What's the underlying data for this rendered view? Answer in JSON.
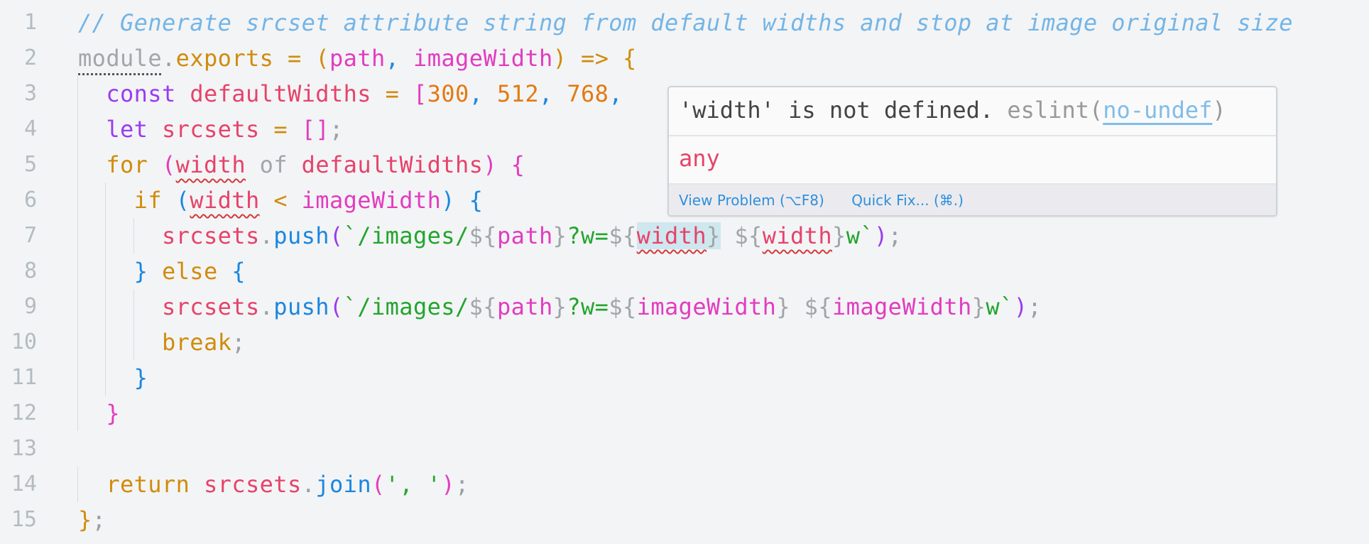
{
  "editor": {
    "lines": [
      {
        "num": "1",
        "indent": 0,
        "tokens": [
          [
            "// Generate srcset attribute string from default widths and stop at image original size",
            "comment"
          ]
        ]
      },
      {
        "num": "2",
        "indent": 0,
        "tokens": [
          [
            "module",
            "gray dots"
          ],
          [
            ".",
            "punc"
          ],
          [
            "exports",
            "ctl"
          ],
          [
            " = ",
            "ob"
          ],
          [
            "(",
            "ob"
          ],
          [
            "path",
            "param"
          ],
          [
            ", ",
            "bb"
          ],
          [
            "imageWidth",
            "param"
          ],
          [
            ")",
            "ob"
          ],
          [
            " => ",
            "ob"
          ],
          [
            "{",
            "ob"
          ]
        ]
      },
      {
        "num": "3",
        "indent": 1,
        "tokens": [
          [
            "const ",
            "kw"
          ],
          [
            "defaultWidths",
            "var"
          ],
          [
            " = ",
            "ob"
          ],
          [
            "[",
            "mb"
          ],
          [
            "300",
            "num"
          ],
          [
            ", ",
            "bb"
          ],
          [
            "512",
            "num"
          ],
          [
            ", ",
            "bb"
          ],
          [
            "768",
            "num"
          ],
          [
            ",",
            "bb"
          ]
        ]
      },
      {
        "num": "4",
        "indent": 1,
        "tokens": [
          [
            "let ",
            "kw"
          ],
          [
            "srcsets",
            "var"
          ],
          [
            " = ",
            "ob"
          ],
          [
            "[]",
            "mb"
          ],
          [
            ";",
            "punc"
          ]
        ]
      },
      {
        "num": "5",
        "indent": 1,
        "tokens": [
          [
            "for ",
            "ctl"
          ],
          [
            "(",
            "mb"
          ],
          [
            "width",
            "var err"
          ],
          [
            " of ",
            "gray"
          ],
          [
            "defaultWidths",
            "var"
          ],
          [
            ")",
            "mb"
          ],
          [
            " ",
            "punc"
          ],
          [
            "{",
            "mb"
          ]
        ]
      },
      {
        "num": "6",
        "indent": 2,
        "tokens": [
          [
            "if ",
            "ctl"
          ],
          [
            "(",
            "bb"
          ],
          [
            "width",
            "var err"
          ],
          [
            " < ",
            "ob"
          ],
          [
            "imageWidth",
            "param"
          ],
          [
            ")",
            "bb"
          ],
          [
            " ",
            "punc"
          ],
          [
            "{",
            "bb"
          ]
        ]
      },
      {
        "num": "7",
        "indent": 3,
        "tokens": [
          [
            "srcsets",
            "var"
          ],
          [
            ".",
            "punc"
          ],
          [
            "push",
            "fn"
          ],
          [
            "(",
            "pb"
          ],
          [
            "`/images/",
            "str"
          ],
          [
            "${",
            "gray"
          ],
          [
            "path",
            "param"
          ],
          [
            "}",
            "gray"
          ],
          [
            "?w=",
            "str"
          ],
          [
            "${",
            "gray"
          ],
          [
            "width",
            "var err hl"
          ],
          [
            "}",
            "gray hl"
          ],
          [
            " ",
            "str"
          ],
          [
            "${",
            "gray"
          ],
          [
            "width",
            "var err"
          ],
          [
            "}",
            "gray"
          ],
          [
            "w`",
            "str"
          ],
          [
            ")",
            "pb"
          ],
          [
            ";",
            "punc"
          ]
        ]
      },
      {
        "num": "8",
        "indent": 2,
        "tokens": [
          [
            "}",
            "bb"
          ],
          [
            " else ",
            "ctl"
          ],
          [
            "{",
            "bb"
          ]
        ]
      },
      {
        "num": "9",
        "indent": 3,
        "tokens": [
          [
            "srcsets",
            "var"
          ],
          [
            ".",
            "punc"
          ],
          [
            "push",
            "fn"
          ],
          [
            "(",
            "pb"
          ],
          [
            "`/images/",
            "str"
          ],
          [
            "${",
            "gray"
          ],
          [
            "path",
            "param"
          ],
          [
            "}",
            "gray"
          ],
          [
            "?w=",
            "str"
          ],
          [
            "${",
            "gray"
          ],
          [
            "imageWidth",
            "param"
          ],
          [
            "}",
            "gray"
          ],
          [
            " ",
            "str"
          ],
          [
            "${",
            "gray"
          ],
          [
            "imageWidth",
            "param"
          ],
          [
            "}",
            "gray"
          ],
          [
            "w`",
            "str"
          ],
          [
            ")",
            "pb"
          ],
          [
            ";",
            "punc"
          ]
        ]
      },
      {
        "num": "10",
        "indent": 3,
        "tokens": [
          [
            "break",
            "ctl"
          ],
          [
            ";",
            "punc"
          ]
        ]
      },
      {
        "num": "11",
        "indent": 2,
        "tokens": [
          [
            "}",
            "bb"
          ]
        ]
      },
      {
        "num": "12",
        "indent": 1,
        "tokens": [
          [
            "}",
            "mb"
          ]
        ]
      },
      {
        "num": "13",
        "indent": 0,
        "tokens": []
      },
      {
        "num": "14",
        "indent": 1,
        "tokens": [
          [
            "return ",
            "ctl"
          ],
          [
            "srcsets",
            "var"
          ],
          [
            ".",
            "punc"
          ],
          [
            "join",
            "fn"
          ],
          [
            "(",
            "mb"
          ],
          [
            "', '",
            "str"
          ],
          [
            ")",
            "mb"
          ],
          [
            ";",
            "punc"
          ]
        ]
      },
      {
        "num": "15",
        "indent": 0,
        "tokens": [
          [
            "}",
            "ob"
          ],
          [
            ";",
            "punc"
          ]
        ]
      }
    ]
  },
  "tooltip": {
    "message": "'width' is not defined.",
    "source": "eslint(",
    "rule": "no-undef",
    "source_close": ")",
    "type": "any",
    "actions": {
      "view_problem": "View Problem (⌥F8)",
      "quick_fix": "Quick Fix... (⌘.)"
    }
  },
  "colors": {
    "background": "#f3f4f6",
    "error_squiggle": "#d33a3a",
    "link": "#2f8fdb"
  }
}
